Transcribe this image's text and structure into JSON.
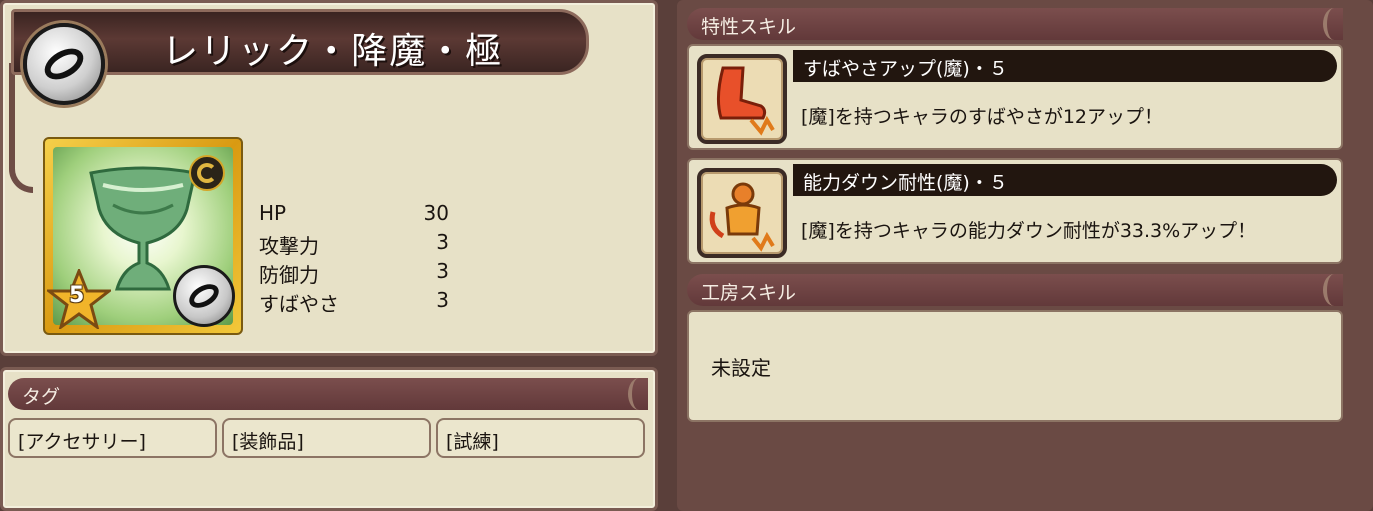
{
  "item": {
    "name": "レリック・降魔・極",
    "rarity_stars": "5"
  },
  "stats": [
    {
      "label": "HP",
      "value": "30"
    },
    {
      "label": "攻撃力",
      "value": "3"
    },
    {
      "label": "防御力",
      "value": "3"
    },
    {
      "label": "すばやさ",
      "value": "3"
    }
  ],
  "tags": {
    "header": "タグ",
    "items": [
      "[アクセサリー]",
      "[装飾品]",
      "[試練]"
    ]
  },
  "traits": {
    "header": "特性スキル",
    "skills": [
      {
        "name": "すばやさアップ(魔)・５",
        "description": "[魔]を持つキャラのすばやさが12アップ！",
        "icon": "boot-icon"
      },
      {
        "name": "能力ダウン耐性(魔)・５",
        "description": "[魔]を持つキャラの能力ダウン耐性が33.3%アップ！",
        "icon": "resist-figure-icon"
      }
    ]
  },
  "workshop": {
    "header": "工房スキル",
    "value": "未設定"
  },
  "colors": {
    "panel_bg": "#e7e1c7",
    "header_bar": "#6d4243",
    "frame": "#5a3f3a"
  }
}
